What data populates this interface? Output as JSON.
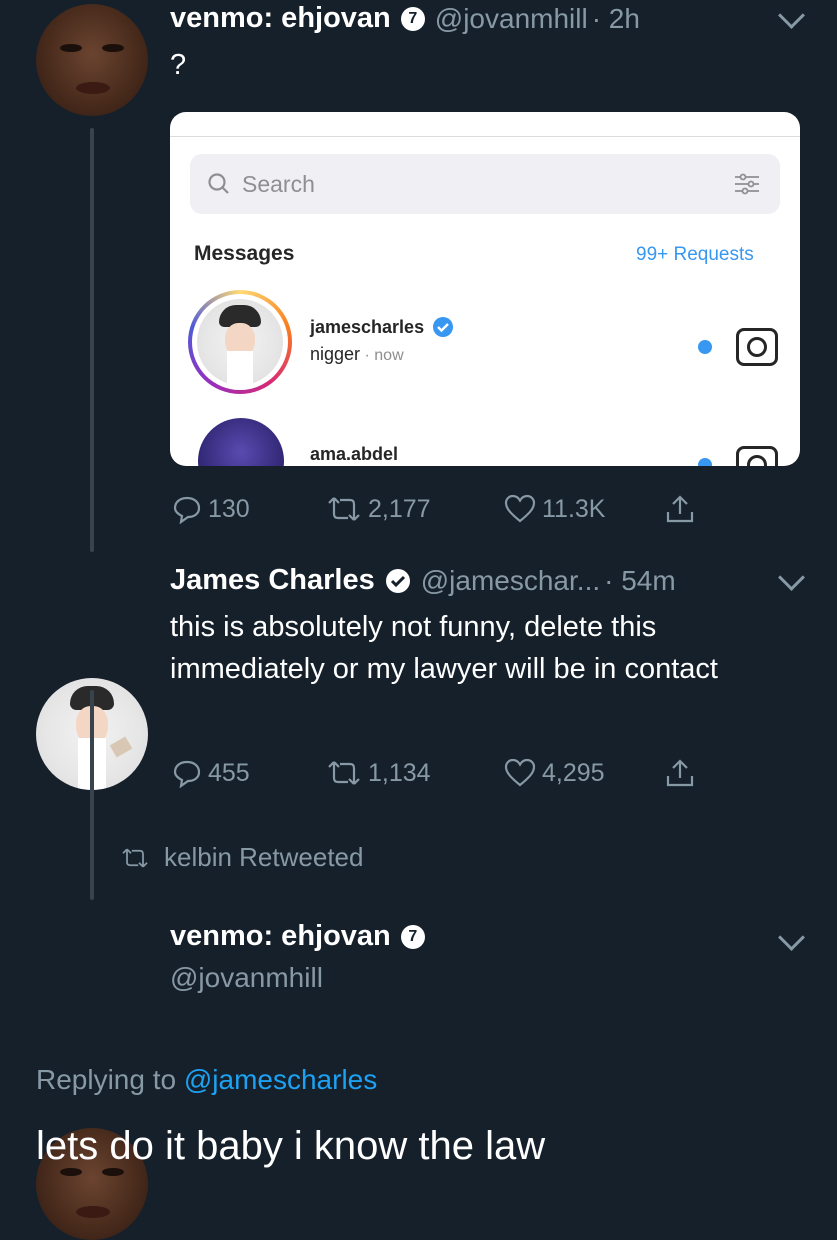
{
  "tweet1": {
    "name": "venmo: ehjovan",
    "handle": "@jovanmhill",
    "time": "· 2h",
    "text": "?",
    "embedded_dm": {
      "search_placeholder": "Search",
      "messages_title": "Messages",
      "requests": "99+ Requests",
      "threads": [
        {
          "user": "jamescharles",
          "preview": "nigger",
          "time": "· now"
        },
        {
          "user": "ama.abdel"
        }
      ]
    },
    "replies": "130",
    "retweets": "2,177",
    "likes": "11.3K"
  },
  "tweet2": {
    "name": "James Charles",
    "handle": "@jameschar...",
    "time": "· 54m",
    "text": "this is absolutely not funny, delete this immediately or my lawyer will be in contact",
    "replies": "455",
    "retweets": "1,134",
    "likes": "4,295"
  },
  "retweet_label": "kelbin Retweeted",
  "tweet3": {
    "name": "venmo: ehjovan",
    "handle": "@jovanmhill",
    "replying_prefix": "Replying to",
    "replying_to": "@jamescharles",
    "text": "lets do it baby i know the law"
  },
  "colors": {
    "background": "#15202b",
    "secondary_text": "#8899a6",
    "link": "#1da1f2"
  }
}
